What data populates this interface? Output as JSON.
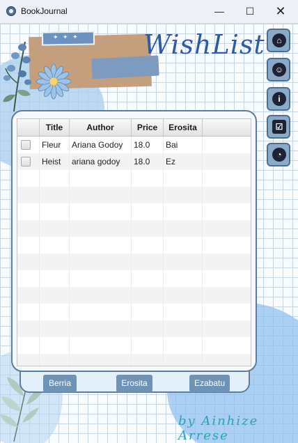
{
  "window": {
    "title": "BookJournal",
    "minimize_glyph": "—",
    "maximize_glyph": "☐",
    "close_glyph": "✕"
  },
  "header": {
    "title": "WishList"
  },
  "sidebar": {
    "buttons": [
      {
        "icon": "home-icon",
        "glyph": "⌂"
      },
      {
        "icon": "user-icon",
        "glyph": "☺"
      },
      {
        "icon": "info-icon",
        "glyph": "i"
      },
      {
        "icon": "checklist-icon",
        "glyph": "☑"
      },
      {
        "icon": "pie-chart-icon",
        "glyph": "◔"
      }
    ]
  },
  "table": {
    "columns": [
      "",
      "Title",
      "Author",
      "Price",
      "Erosita"
    ],
    "rows": [
      {
        "checked": false,
        "title": "Fleur",
        "author": "Ariana Godoy",
        "price": "18.0",
        "erosita": "Bai"
      },
      {
        "checked": false,
        "title": "Heist",
        "author": "ariana godoy",
        "price": "18.0",
        "erosita": "Ez"
      }
    ]
  },
  "actions": {
    "new_label": "Berria",
    "buy_label": "Erosita",
    "delete_label": "Ezabatu"
  },
  "footer": {
    "signature": "by Ainhize Arrese"
  },
  "colors": {
    "accent": "#6f92b7",
    "panel_border": "#5c7d9c",
    "title_blue": "#2f5aa6",
    "signature": "#2aa4b8"
  }
}
